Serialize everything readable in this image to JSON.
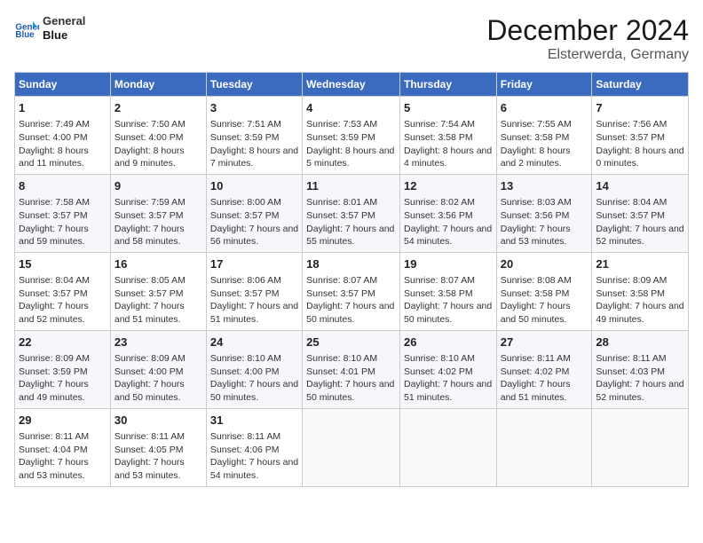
{
  "header": {
    "logo": {
      "line1": "General",
      "line2": "Blue"
    },
    "title": "December 2024",
    "subtitle": "Elsterwerda, Germany"
  },
  "weekdays": [
    "Sunday",
    "Monday",
    "Tuesday",
    "Wednesday",
    "Thursday",
    "Friday",
    "Saturday"
  ],
  "weeks": [
    [
      {
        "day": "1",
        "info": "Sunrise: 7:49 AM\nSunset: 4:00 PM\nDaylight: 8 hours and 11 minutes."
      },
      {
        "day": "2",
        "info": "Sunrise: 7:50 AM\nSunset: 4:00 PM\nDaylight: 8 hours and 9 minutes."
      },
      {
        "day": "3",
        "info": "Sunrise: 7:51 AM\nSunset: 3:59 PM\nDaylight: 8 hours and 7 minutes."
      },
      {
        "day": "4",
        "info": "Sunrise: 7:53 AM\nSunset: 3:59 PM\nDaylight: 8 hours and 5 minutes."
      },
      {
        "day": "5",
        "info": "Sunrise: 7:54 AM\nSunset: 3:58 PM\nDaylight: 8 hours and 4 minutes."
      },
      {
        "day": "6",
        "info": "Sunrise: 7:55 AM\nSunset: 3:58 PM\nDaylight: 8 hours and 2 minutes."
      },
      {
        "day": "7",
        "info": "Sunrise: 7:56 AM\nSunset: 3:57 PM\nDaylight: 8 hours and 0 minutes."
      }
    ],
    [
      {
        "day": "8",
        "info": "Sunrise: 7:58 AM\nSunset: 3:57 PM\nDaylight: 7 hours and 59 minutes."
      },
      {
        "day": "9",
        "info": "Sunrise: 7:59 AM\nSunset: 3:57 PM\nDaylight: 7 hours and 58 minutes."
      },
      {
        "day": "10",
        "info": "Sunrise: 8:00 AM\nSunset: 3:57 PM\nDaylight: 7 hours and 56 minutes."
      },
      {
        "day": "11",
        "info": "Sunrise: 8:01 AM\nSunset: 3:57 PM\nDaylight: 7 hours and 55 minutes."
      },
      {
        "day": "12",
        "info": "Sunrise: 8:02 AM\nSunset: 3:56 PM\nDaylight: 7 hours and 54 minutes."
      },
      {
        "day": "13",
        "info": "Sunrise: 8:03 AM\nSunset: 3:56 PM\nDaylight: 7 hours and 53 minutes."
      },
      {
        "day": "14",
        "info": "Sunrise: 8:04 AM\nSunset: 3:57 PM\nDaylight: 7 hours and 52 minutes."
      }
    ],
    [
      {
        "day": "15",
        "info": "Sunrise: 8:04 AM\nSunset: 3:57 PM\nDaylight: 7 hours and 52 minutes."
      },
      {
        "day": "16",
        "info": "Sunrise: 8:05 AM\nSunset: 3:57 PM\nDaylight: 7 hours and 51 minutes."
      },
      {
        "day": "17",
        "info": "Sunrise: 8:06 AM\nSunset: 3:57 PM\nDaylight: 7 hours and 51 minutes."
      },
      {
        "day": "18",
        "info": "Sunrise: 8:07 AM\nSunset: 3:57 PM\nDaylight: 7 hours and 50 minutes."
      },
      {
        "day": "19",
        "info": "Sunrise: 8:07 AM\nSunset: 3:58 PM\nDaylight: 7 hours and 50 minutes."
      },
      {
        "day": "20",
        "info": "Sunrise: 8:08 AM\nSunset: 3:58 PM\nDaylight: 7 hours and 50 minutes."
      },
      {
        "day": "21",
        "info": "Sunrise: 8:09 AM\nSunset: 3:58 PM\nDaylight: 7 hours and 49 minutes."
      }
    ],
    [
      {
        "day": "22",
        "info": "Sunrise: 8:09 AM\nSunset: 3:59 PM\nDaylight: 7 hours and 49 minutes."
      },
      {
        "day": "23",
        "info": "Sunrise: 8:09 AM\nSunset: 4:00 PM\nDaylight: 7 hours and 50 minutes."
      },
      {
        "day": "24",
        "info": "Sunrise: 8:10 AM\nSunset: 4:00 PM\nDaylight: 7 hours and 50 minutes."
      },
      {
        "day": "25",
        "info": "Sunrise: 8:10 AM\nSunset: 4:01 PM\nDaylight: 7 hours and 50 minutes."
      },
      {
        "day": "26",
        "info": "Sunrise: 8:10 AM\nSunset: 4:02 PM\nDaylight: 7 hours and 51 minutes."
      },
      {
        "day": "27",
        "info": "Sunrise: 8:11 AM\nSunset: 4:02 PM\nDaylight: 7 hours and 51 minutes."
      },
      {
        "day": "28",
        "info": "Sunrise: 8:11 AM\nSunset: 4:03 PM\nDaylight: 7 hours and 52 minutes."
      }
    ],
    [
      {
        "day": "29",
        "info": "Sunrise: 8:11 AM\nSunset: 4:04 PM\nDaylight: 7 hours and 53 minutes."
      },
      {
        "day": "30",
        "info": "Sunrise: 8:11 AM\nSunset: 4:05 PM\nDaylight: 7 hours and 53 minutes."
      },
      {
        "day": "31",
        "info": "Sunrise: 8:11 AM\nSunset: 4:06 PM\nDaylight: 7 hours and 54 minutes."
      },
      null,
      null,
      null,
      null
    ]
  ]
}
